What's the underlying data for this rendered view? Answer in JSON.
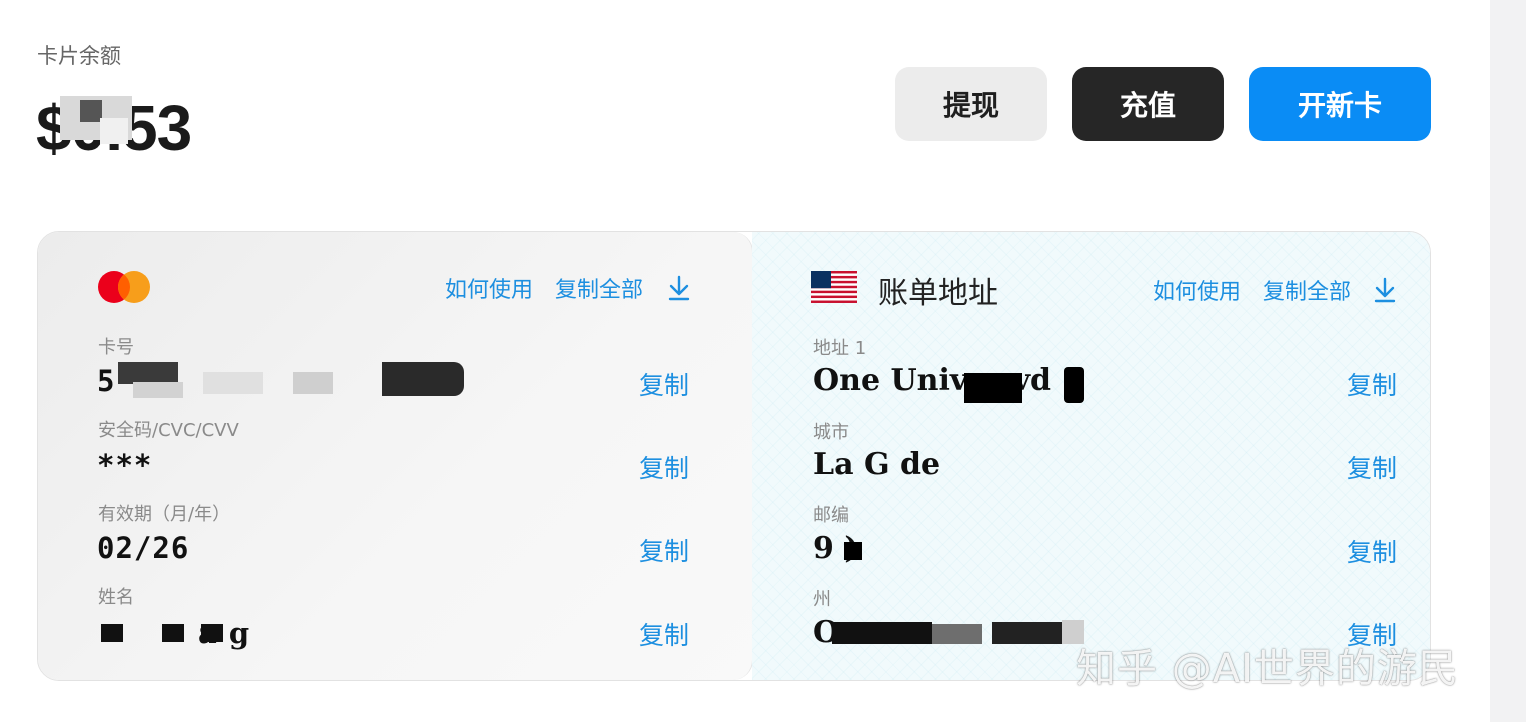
{
  "balance": {
    "label": "卡片余额",
    "amount": "$0.53"
  },
  "actions": {
    "withdraw": "提现",
    "topup": "充值",
    "new_card": "开新卡"
  },
  "card": {
    "brand_icon": "mastercard-logo",
    "how_to_use": "如何使用",
    "copy_all": "复制全部",
    "fields": {
      "number": {
        "label": "卡号",
        "value": "5 ",
        "copy": "复制"
      },
      "cvc": {
        "label": "安全码/CVC/CVV",
        "value": "***",
        "copy": "复制"
      },
      "expiry": {
        "label": "有效期（月/年）",
        "value": "02/26",
        "copy": "复制"
      },
      "name": {
        "label": "姓名",
        "value": "a g",
        "copy": "复制"
      }
    }
  },
  "billing": {
    "flag_icon": "us-flag-icon",
    "title": "账单地址",
    "how_to_use": "如何使用",
    "copy_all": "复制全部",
    "fields": {
      "address": {
        "label": "地址 1",
        "value": "One Univer      vd",
        "copy": "复制"
      },
      "city": {
        "label": "城市",
        "value": "La G    de",
        "copy": "复制"
      },
      "zip": {
        "label": "邮编",
        "value": "9   )",
        "copy": "复制"
      },
      "state": {
        "label": "州",
        "value": "O         ",
        "copy": "复制"
      }
    }
  },
  "watermark": "知乎 @AI世界的游民",
  "colors": {
    "accent": "#0a8cf5",
    "link": "#1d8fe0",
    "dark_button": "#262626"
  }
}
